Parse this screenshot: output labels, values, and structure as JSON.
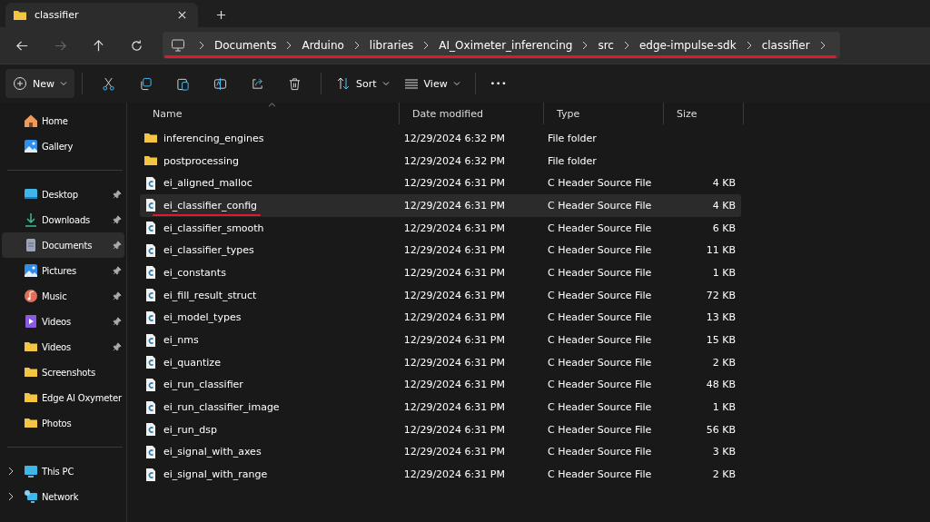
{
  "tabs": [
    {
      "title": "classifier",
      "selected": true
    }
  ],
  "address": {
    "annotated": true,
    "segments": [
      "Documents",
      "Arduino",
      "libraries",
      "AI_Oximeter_inferencing",
      "src",
      "edge-impulse-sdk",
      "classifier"
    ]
  },
  "toolbar": {
    "new_label": "New",
    "sort_label": "Sort",
    "view_label": "View",
    "more": "•••"
  },
  "sidebar": {
    "groups": [
      [
        {
          "kind": "home",
          "label": "Home",
          "pinned": false,
          "selected": false
        },
        {
          "kind": "gallery",
          "label": "Gallery",
          "pinned": false,
          "selected": false
        }
      ],
      [
        {
          "kind": "desktop",
          "label": "Desktop",
          "pinned": true,
          "selected": false
        },
        {
          "kind": "downloads",
          "label": "Downloads",
          "pinned": true,
          "selected": false
        },
        {
          "kind": "documents",
          "label": "Documents",
          "pinned": true,
          "selected": true
        },
        {
          "kind": "pictures",
          "label": "Pictures",
          "pinned": true,
          "selected": false
        },
        {
          "kind": "music",
          "label": "Music",
          "pinned": true,
          "selected": false
        },
        {
          "kind": "videos",
          "label": "Videos",
          "pinned": true,
          "selected": false
        },
        {
          "kind": "folder",
          "label": "Videos",
          "pinned": true,
          "selected": false
        },
        {
          "kind": "folder",
          "label": "Screenshots",
          "pinned": false,
          "selected": false
        },
        {
          "kind": "folder",
          "label": "Edge AI Oxymeter",
          "pinned": false,
          "selected": false
        },
        {
          "kind": "folder",
          "label": "Photos",
          "pinned": false,
          "selected": false
        }
      ],
      [
        {
          "kind": "pc",
          "label": "This PC",
          "expanded": false,
          "selected": false
        },
        {
          "kind": "network",
          "label": "Network",
          "expanded": false,
          "selected": false
        }
      ]
    ]
  },
  "table": {
    "columns": [
      "Name",
      "Date modified",
      "Type",
      "Size"
    ],
    "rows": [
      {
        "kind": "folder",
        "name": "inferencing_engines",
        "date": "12/29/2024 6:32 PM",
        "type": "File folder",
        "selected": false,
        "annotated": false
      },
      {
        "kind": "folder",
        "name": "postprocessing",
        "date": "12/29/2024 6:32 PM",
        "type": "File folder",
        "selected": false,
        "annotated": false
      },
      {
        "kind": "header",
        "name": "ei_aligned_malloc",
        "date": "12/29/2024 6:31 PM",
        "type": "C Header Source File",
        "size": "4 KB",
        "selected": false,
        "annotated": false
      },
      {
        "kind": "header",
        "name": "ei_classifier_config",
        "date": "12/29/2024 6:31 PM",
        "type": "C Header Source File",
        "size": "4 KB",
        "selected": true,
        "annotated": true
      },
      {
        "kind": "header",
        "name": "ei_classifier_smooth",
        "date": "12/29/2024 6:31 PM",
        "type": "C Header Source File",
        "size": "6 KB",
        "selected": false,
        "annotated": false
      },
      {
        "kind": "header",
        "name": "ei_classifier_types",
        "date": "12/29/2024 6:31 PM",
        "type": "C Header Source File",
        "size": "11 KB",
        "selected": false,
        "annotated": false
      },
      {
        "kind": "header",
        "name": "ei_constants",
        "date": "12/29/2024 6:31 PM",
        "type": "C Header Source File",
        "size": "1 KB",
        "selected": false,
        "annotated": false
      },
      {
        "kind": "header",
        "name": "ei_fill_result_struct",
        "date": "12/29/2024 6:31 PM",
        "type": "C Header Source File",
        "size": "72 KB",
        "selected": false,
        "annotated": false
      },
      {
        "kind": "header",
        "name": "ei_model_types",
        "date": "12/29/2024 6:31 PM",
        "type": "C Header Source File",
        "size": "13 KB",
        "selected": false,
        "annotated": false
      },
      {
        "kind": "header",
        "name": "ei_nms",
        "date": "12/29/2024 6:31 PM",
        "type": "C Header Source File",
        "size": "15 KB",
        "selected": false,
        "annotated": false
      },
      {
        "kind": "header",
        "name": "ei_quantize",
        "date": "12/29/2024 6:31 PM",
        "type": "C Header Source File",
        "size": "2 KB",
        "selected": false,
        "annotated": false
      },
      {
        "kind": "header",
        "name": "ei_run_classifier",
        "date": "12/29/2024 6:31 PM",
        "type": "C Header Source File",
        "size": "48 KB",
        "selected": false,
        "annotated": false
      },
      {
        "kind": "header",
        "name": "ei_run_classifier_image",
        "date": "12/29/2024 6:31 PM",
        "type": "C Header Source File",
        "size": "1 KB",
        "selected": false,
        "annotated": false
      },
      {
        "kind": "header",
        "name": "ei_run_dsp",
        "date": "12/29/2024 6:31 PM",
        "type": "C Header Source File",
        "size": "56 KB",
        "selected": false,
        "annotated": false
      },
      {
        "kind": "header",
        "name": "ei_signal_with_axes",
        "date": "12/29/2024 6:31 PM",
        "type": "C Header Source File",
        "size": "3 KB",
        "selected": false,
        "annotated": false
      },
      {
        "kind": "header",
        "name": "ei_signal_with_range",
        "date": "12/29/2024 6:31 PM",
        "type": "C Header Source File",
        "size": "2 KB",
        "selected": false,
        "annotated": false
      }
    ]
  }
}
